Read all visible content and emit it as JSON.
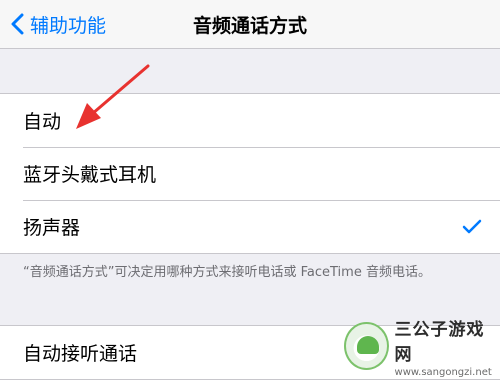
{
  "nav": {
    "back_label": "辅助功能",
    "title": "音频通话方式"
  },
  "audio_routing": {
    "options": [
      {
        "label": "自动",
        "selected": false
      },
      {
        "label": "蓝牙头戴式耳机",
        "selected": false
      },
      {
        "label": "扬声器",
        "selected": true
      }
    ],
    "footer": "“音频通话方式”可决定用哪种方式来接听电话或 FaceTime 音频电话。"
  },
  "auto_answer": {
    "label": "自动接听通话"
  },
  "watermark": {
    "title": "三公子游戏网",
    "url": "www.sangongzi.net"
  },
  "colors": {
    "accent": "#007aff",
    "annotation_arrow": "#e8322f",
    "background": "#efeff4"
  }
}
